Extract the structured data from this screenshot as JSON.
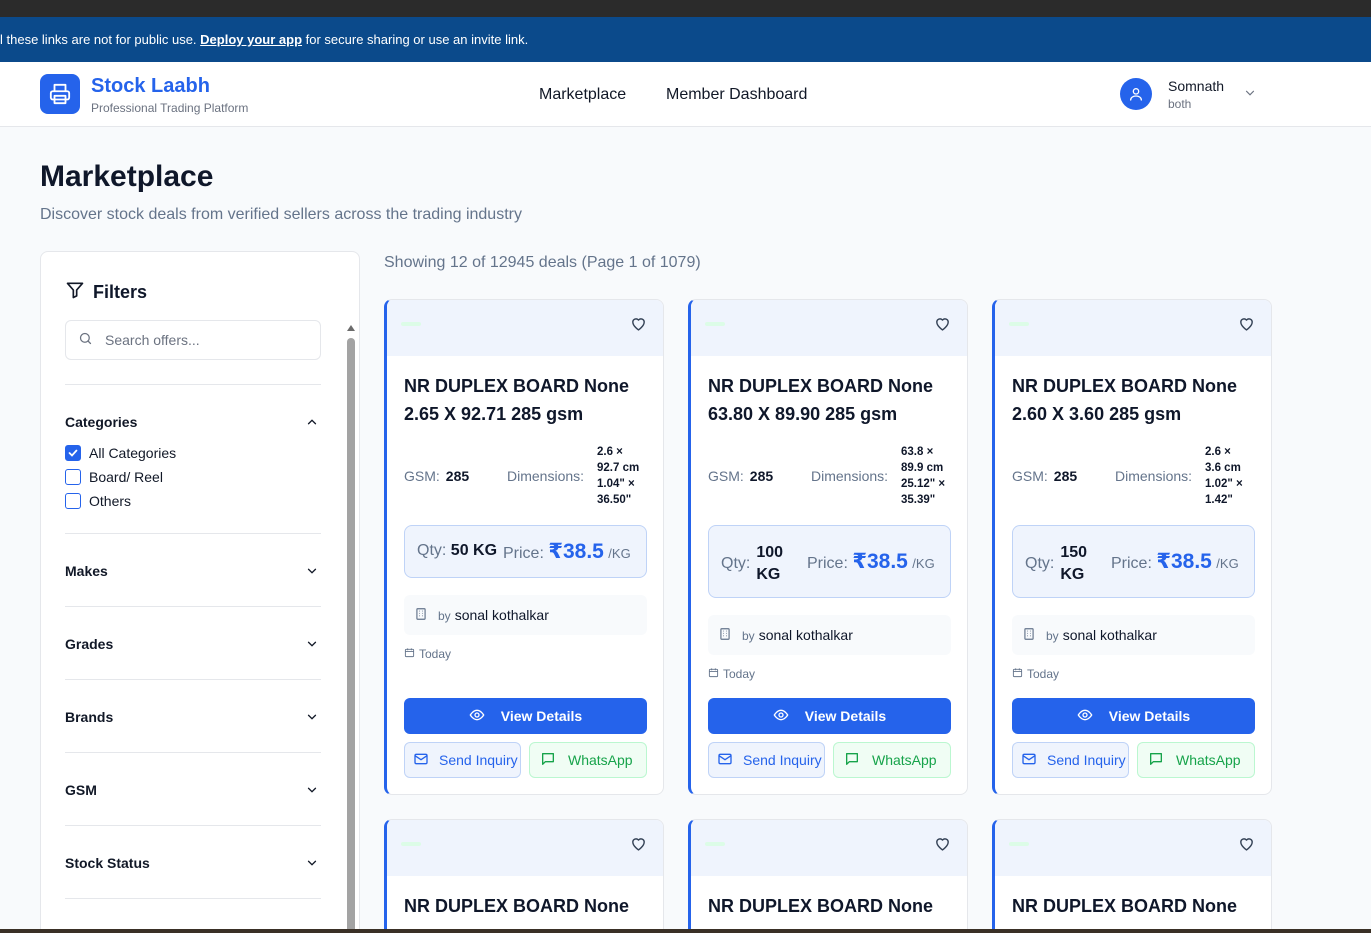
{
  "banner": {
    "text_before": "l these links are not for public use. ",
    "link": "Deploy your app",
    "text_after": " for secure sharing or use an invite link."
  },
  "header": {
    "brand_title": "Stock Laabh",
    "brand_subtitle": "Professional Trading Platform",
    "nav": [
      "Marketplace",
      "Member Dashboard"
    ],
    "user_name": "Somnath",
    "user_role": "both"
  },
  "page": {
    "title": "Marketplace",
    "subtitle": "Discover stock deals from verified sellers across the trading industry",
    "showing": "Showing 12 of 12945 deals (Page 1 of 1079)"
  },
  "filters": {
    "heading": "Filters",
    "search_placeholder": "Search offers...",
    "categories_label": "Categories",
    "categories": [
      {
        "label": "All Categories",
        "checked": true
      },
      {
        "label": "Board/ Reel",
        "checked": false
      },
      {
        "label": "Others",
        "checked": false
      }
    ],
    "sections": [
      "Makes",
      "Grades",
      "Brands",
      "GSM",
      "Stock Status"
    ]
  },
  "cards": [
    {
      "title": "NR DUPLEX BOARD None 2.65 X 92.71 285 gsm",
      "gsm_label": "GSM:",
      "gsm": "285",
      "dim_label": "Dimensions:",
      "dims": [
        "2.6 ×",
        "92.7 cm",
        "1.04\" ×",
        "36.50\""
      ],
      "qty_label": "Qty:",
      "qty": "50 KG",
      "price_label": "Price:",
      "price": "₹38.5",
      "unit": "/KG",
      "by": "by",
      "seller": "sonal kothalkar",
      "date": "Today",
      "view": "View Details",
      "inquiry": "Send Inquiry",
      "whatsapp": "WhatsApp"
    },
    {
      "title": "NR DUPLEX BOARD None 63.80 X 89.90 285 gsm",
      "gsm_label": "GSM:",
      "gsm": "285",
      "dim_label": "Dimensions:",
      "dims": [
        "63.8 ×",
        "89.9 cm",
        "25.12\" ×",
        "35.39\""
      ],
      "qty_label": "Qty:",
      "qty": "100 KG",
      "price_label": "Price:",
      "price": "₹38.5",
      "unit": "/KG",
      "by": "by",
      "seller": "sonal kothalkar",
      "date": "Today",
      "view": "View Details",
      "inquiry": "Send Inquiry",
      "whatsapp": "WhatsApp"
    },
    {
      "title": "NR DUPLEX BOARD None 2.60 X 3.60 285 gsm",
      "gsm_label": "GSM:",
      "gsm": "285",
      "dim_label": "Dimensions:",
      "dims": [
        "2.6 ×",
        "3.6 cm",
        "1.02\" ×",
        "1.42\""
      ],
      "qty_label": "Qty:",
      "qty": "150 KG",
      "price_label": "Price:",
      "price": "₹38.5",
      "unit": "/KG",
      "by": "by",
      "seller": "sonal kothalkar",
      "date": "Today",
      "view": "View Details",
      "inquiry": "Send Inquiry",
      "whatsapp": "WhatsApp"
    }
  ],
  "next_row_titles": [
    "NR DUPLEX BOARD None",
    "NR DUPLEX BOARD None",
    "NR DUPLEX BOARD None"
  ],
  "colors": {
    "primary": "#2563eb",
    "banner": "#0b4a8b",
    "whatsapp": "#16a34a"
  }
}
